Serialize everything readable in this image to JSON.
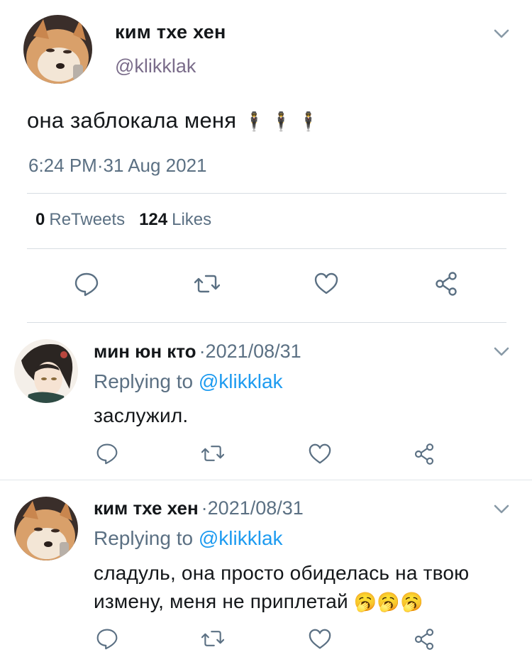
{
  "main_tweet": {
    "display_name": "ким тхе хен",
    "handle": "@klikklak",
    "text": "она заблокала меня",
    "emoji": "🕴🕴🕴",
    "timestamp": "6:24 PM·31 Aug 2021",
    "retweets_count": "0",
    "retweets_label": "ReTweets",
    "likes_count": "124",
    "likes_label": "Likes"
  },
  "replies": [
    {
      "display_name": "мин юн кто",
      "date": "·2021/08/31",
      "replying_prefix": "Replying to",
      "replying_handle": "@klikklak",
      "text_lines": [
        "заслужил."
      ],
      "emoji": ""
    },
    {
      "display_name": "ким тхе хен",
      "date": "·2021/08/31",
      "replying_prefix": "Replying to",
      "replying_handle": "@klikklak",
      "text_lines": [
        "сладуль, она просто обиделась на твою",
        "измену, меня не приплетай"
      ],
      "emoji": "🥱🥱🥱"
    }
  ],
  "icons": {
    "reply": "reply-icon",
    "retweet": "retweet-icon",
    "like": "heart-icon",
    "share": "share-icon",
    "more": "chevron-down-icon"
  },
  "colors": {
    "text": "#14171a",
    "muted": "#5b7083",
    "handle": "#7a6c8a",
    "mention": "#1d9bf0",
    "divider": "#d7dde2"
  }
}
